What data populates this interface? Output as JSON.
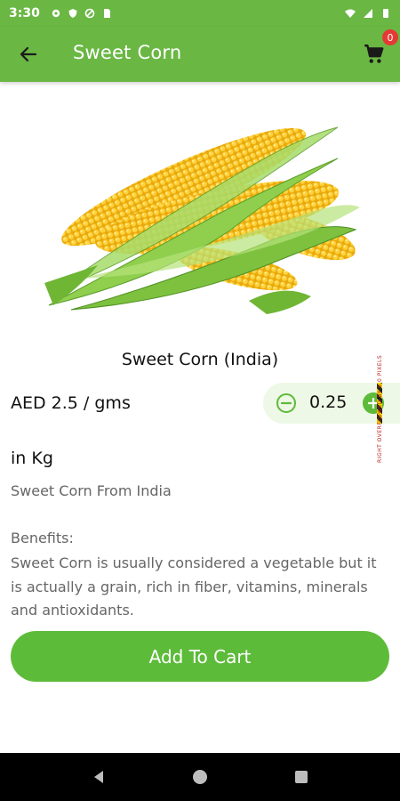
{
  "status_bar": {
    "time": "3:30",
    "left_icons": [
      "gear-icon",
      "shield-icon",
      "no-data-icon",
      "sim-card-icon"
    ],
    "right_icons": [
      "wifi-icon",
      "signal-icon",
      "battery-icon"
    ]
  },
  "app_bar": {
    "title": "Sweet Corn",
    "cart_count": "0",
    "color": "#6ab744"
  },
  "product": {
    "name": "Sweet Corn (India)",
    "price": "AED 2.5 / gms",
    "quantity": "0.25",
    "unit": "in Kg",
    "description": "Sweet Corn From India",
    "benefits_label": "Benefits:",
    "benefits_text": "Sweet Corn is usually considered a vegetable but it is actually a grain, rich in fiber, vitamins, minerals and antioxidants."
  },
  "overflow_warning": "RIGHT OVERFLOWED BY 5.0 PIXELS",
  "add_to_cart_label": "Add To Cart",
  "accent_color": "#5dbb3a"
}
